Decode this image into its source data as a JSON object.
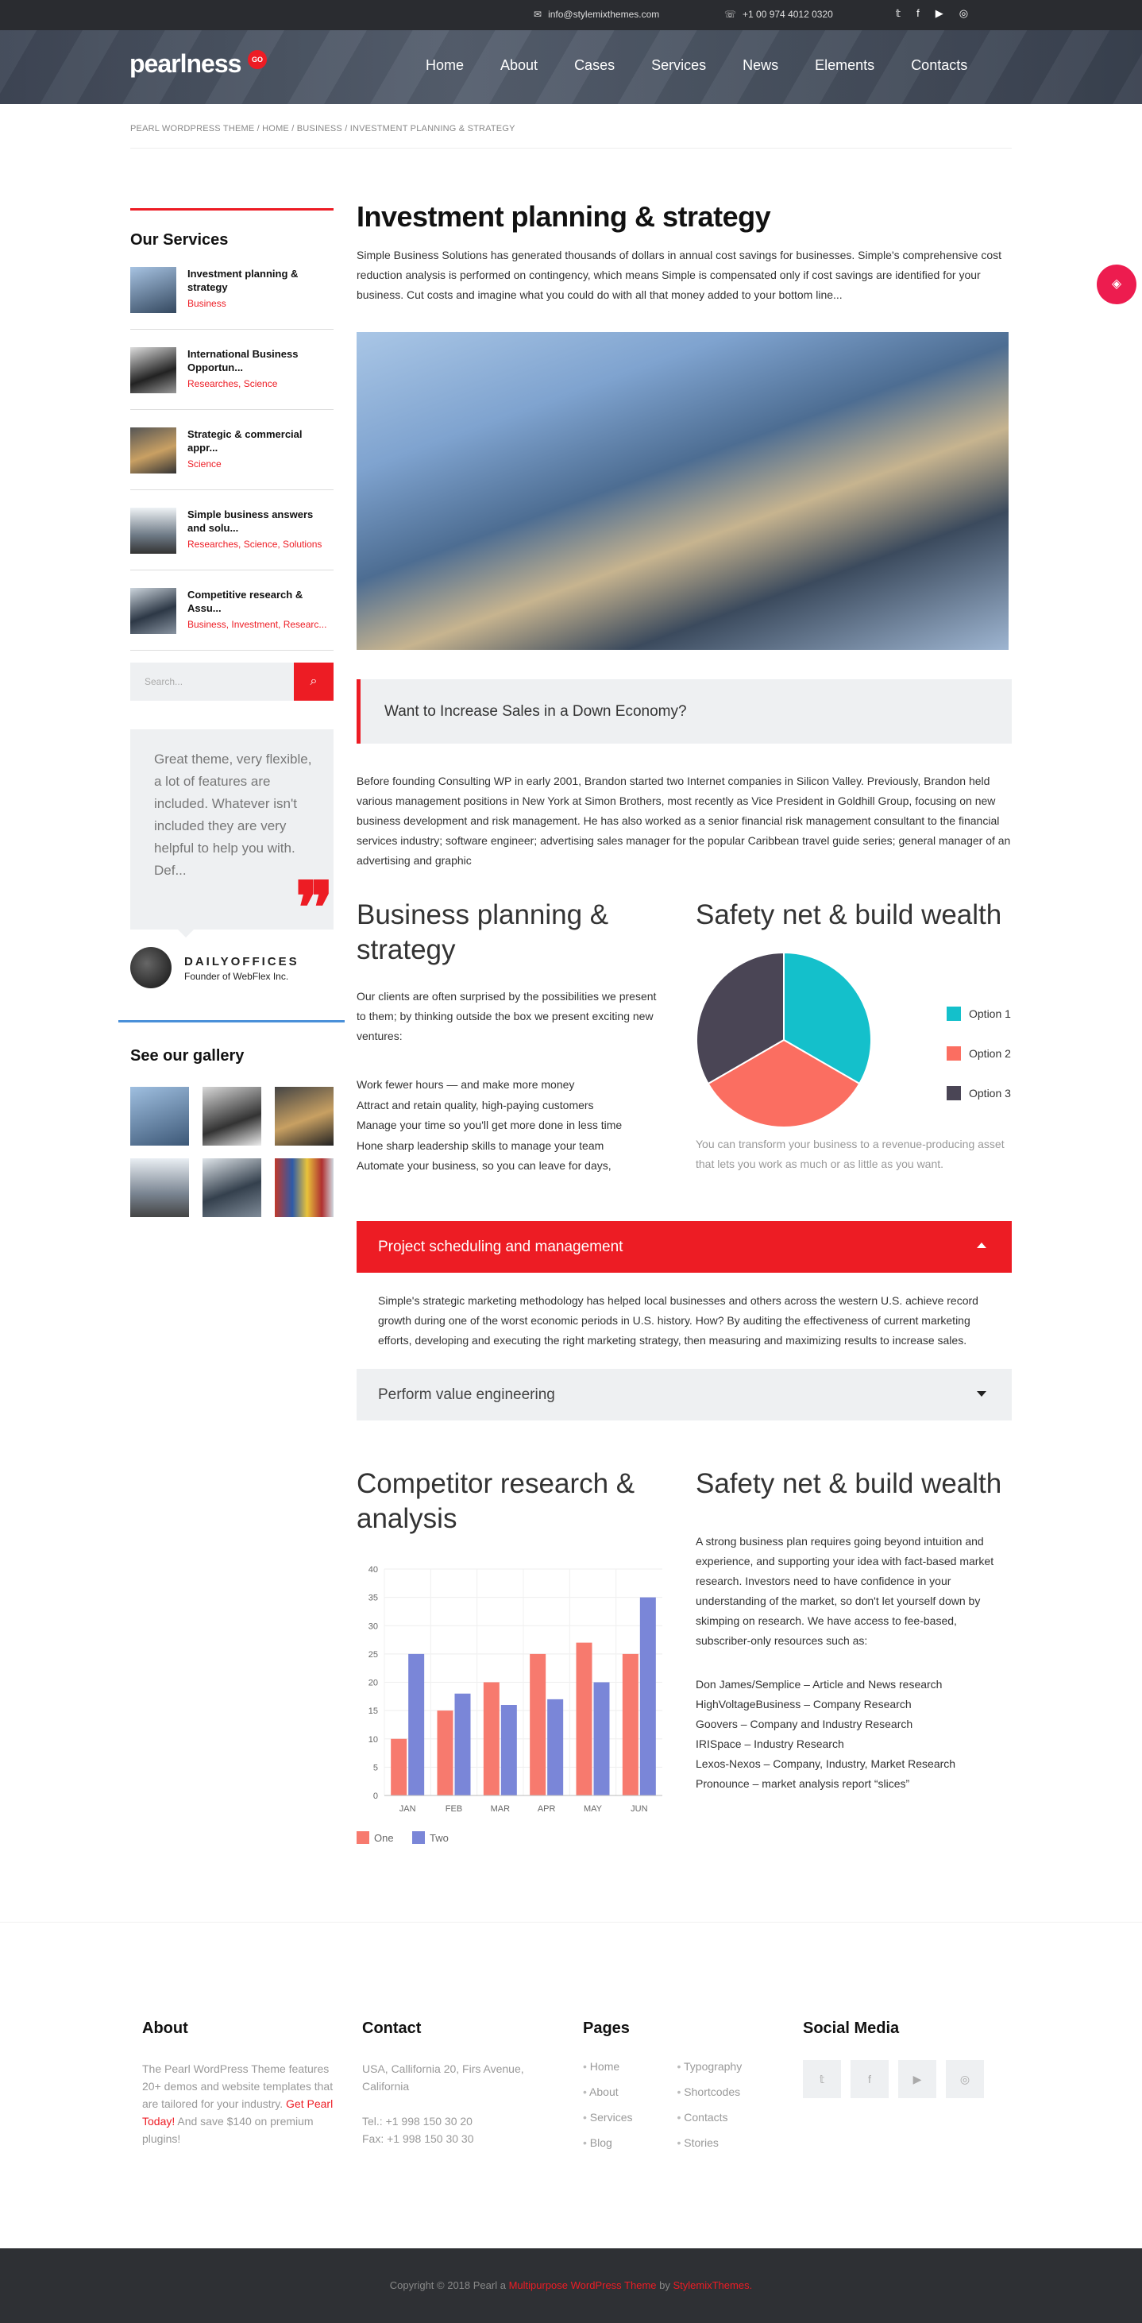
{
  "topbar": {
    "email": "info@stylemixthemes.com",
    "phone": "+1 00 974 4012 0320",
    "social_icons": [
      "twitter-icon",
      "facebook-icon",
      "youtube-icon",
      "instagram-icon"
    ]
  },
  "header": {
    "logo": "pearlness",
    "logo_badge": "GO",
    "nav": [
      "Home",
      "About",
      "Cases",
      "Services",
      "News",
      "Elements",
      "Contacts"
    ]
  },
  "breadcrumb": "PEARL WORDPRESS THEME / HOME / BUSINESS / INVESTMENT PLANNING & STRATEGY",
  "colors": {
    "accent": "#ed1c24",
    "dark": "#2a2c30",
    "light_bg": "#eef0f2",
    "link_blue": "#4a90d9"
  },
  "sidebar": {
    "services_title": "Our Services",
    "services": [
      {
        "name": "Investment planning & strategy",
        "cats": "Business"
      },
      {
        "name": "International Business Opportun...",
        "cats": "Researches, Science"
      },
      {
        "name": "Strategic & commercial appr...",
        "cats": "Science"
      },
      {
        "name": "Simple business answers and solu...",
        "cats": "Researches, Science, Solutions"
      },
      {
        "name": "Competitive research & Assu...",
        "cats": "Business, Investment, Researc..."
      }
    ],
    "search_placeholder": "Search...",
    "testimonial": "Great theme, very flexible, a lot of features are included. Whatever isn't included they are very helpful to help you with. Def...",
    "author_name": "DAILYOFFICES",
    "author_role": "Founder of WebFlex Inc.",
    "gallery_title": "See our gallery"
  },
  "main": {
    "title": "Investment planning & strategy",
    "intro": "Simple Business Solutions has generated thousands of dollars in annual cost savings for businesses. Simple's comprehensive cost reduction analysis is performed on contingency, which means Simple is compensated only if cost savings are identified for your business. Cut costs and imagine what you could do with all that money added to your bottom line...",
    "blockquote": "Want to Increase Sales in a Down Economy?",
    "para2": "Before founding Consulting WP in early 2001, Brandon started two Internet companies in Silicon Valley. Previously, Brandon held various management positions in New York at Simon Brothers, most recently as Vice President in Goldhill Group, focusing on new business development and risk management. He has also worked as a senior financial risk management consultant to the financial services industry; software engineer; advertising sales manager for the popular Caribbean travel guide series; general manager of an advertising and graphic",
    "bp_title": "Business planning & strategy",
    "bp_text": "Our clients are often surprised by the possibilities we present to them; by thinking outside the box we present exciting new ventures:",
    "bp_list": [
      "Work fewer hours — and make more money",
      "Attract and retain quality, high-paying customers",
      "Manage your time so you'll get more done in less time",
      "Hone sharp leadership skills to manage your team",
      "Automate your business, so you can leave for days,"
    ],
    "sn_title": "Safety net & build wealth",
    "pie_note": "You can transform your business to a revenue-producing asset that lets you work as much or as little as you want.",
    "acc1_title": "Project scheduling and management",
    "acc1_body": "Simple's strategic marketing methodology has helped local businesses and others across the western U.S. achieve record growth during one of the worst economic periods in U.S. history. How? By auditing the effectiveness of current marketing efforts, developing and executing the right marketing strategy, then measuring and maximizing results to increase sales.",
    "acc2_title": "Perform value engineering",
    "cr_title": "Competitor research & analysis",
    "sn2_title": "Safety net & build wealth",
    "sn2_text": "A strong business plan requires going beyond intuition and experience, and supporting your idea with fact-based market research. Investors need to have confidence in your understanding of the market, so don't let yourself down by skimping on research. We have access to fee-based, subscriber-only resources such as:",
    "sn2_list": [
      "Don James/Semplice – Article and News research",
      "HighVoltageBusiness – Company Research",
      "Goovers – Company and Industry Research",
      "IRISpace – Industry Research",
      "Lexos-Nexos – Company, Industry, Market Research",
      "Pronounce – market analysis report “slices”"
    ]
  },
  "chart_data": [
    {
      "type": "pie",
      "labels": [
        "Option 1",
        "Option 2",
        "Option 3"
      ],
      "values": [
        33.3,
        33.3,
        33.3
      ],
      "colors": [
        "#14c0cb",
        "#fb6e61",
        "#4a4555"
      ],
      "legend": "right"
    },
    {
      "type": "bar",
      "categories": [
        "JAN",
        "FEB",
        "MAR",
        "APR",
        "MAY",
        "JUN"
      ],
      "series": [
        {
          "name": "One",
          "values": [
            10,
            15,
            20,
            25,
            27,
            25
          ],
          "color": "#f77a6e"
        },
        {
          "name": "Two",
          "values": [
            25,
            18,
            16,
            17,
            20,
            35
          ],
          "color": "#7a86d8"
        }
      ],
      "ylim": [
        0,
        40
      ],
      "yticks": [
        0,
        5,
        10,
        15,
        20,
        25,
        30,
        35,
        40
      ],
      "grid": true,
      "legend": "bottom-left"
    }
  ],
  "footer": {
    "about_title": "About",
    "about_text": "The Pearl WordPress Theme features 20+ demos and website templates that are tailored for your industry.",
    "about_link": "Get Pearl Today!",
    "about_tail": "And save $140 on premium plugins!",
    "contact_title": "Contact",
    "address": "USA, Callifornia 20, Firs Avenue, California",
    "tel": "Tel.: +1 998 150 30 20",
    "fax": "Fax: +1 998 150 30 30",
    "pages_title": "Pages",
    "pages_col1": [
      "Home",
      "About",
      "Services",
      "Blog"
    ],
    "pages_col2": [
      "Typography",
      "Shortcodes",
      "Contacts",
      "Stories"
    ],
    "social_title": "Social Media",
    "copy_pre": "Copyright © 2018 Pearl a",
    "copy_link1": "Multipurpose WordPress Theme",
    "copy_mid": "by",
    "copy_link2": "StylemixThemes."
  }
}
